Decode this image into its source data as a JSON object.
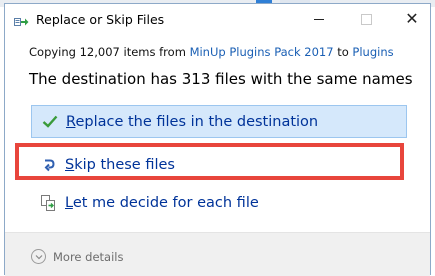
{
  "dialog": {
    "title": "Replace or Skip Files",
    "copying": {
      "prefix": "Copying 12,007 items from ",
      "source": "MinUp Plugins Pack 2017",
      "middle": " to ",
      "destination": "Plugins"
    },
    "headline": "The destination has 313 files with the same names",
    "options": {
      "replace": {
        "mnemonic": "R",
        "rest": "eplace the files in the destination",
        "icon": "checkmark-icon"
      },
      "skip": {
        "mnemonic": "S",
        "rest": "kip these files",
        "icon": "skip-arrow-icon"
      },
      "decide": {
        "mnemonic": "L",
        "rest": "et me decide for each file",
        "icon": "compare-files-icon"
      }
    },
    "more_details": "More details"
  },
  "colors": {
    "link": "#1a5fb4",
    "option_text": "#003399",
    "selected_bg": "#d5e8fb",
    "highlight": "#e8453c",
    "check": "#3a9b3a"
  }
}
